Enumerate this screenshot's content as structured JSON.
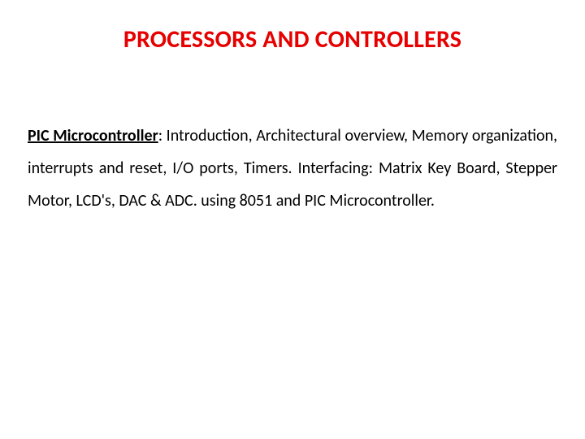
{
  "title": "PROCESSORS AND CONTROLLERS",
  "body": {
    "topic_label": "PIC Microcontroller",
    "description": ": Introduction, Architectural overview, Memory organization, interrupts and reset, I/O ports, Timers. Interfacing: Matrix Key Board, Stepper Motor, LCD's, DAC & ADC. using 8051 and PIC Microcontroller."
  }
}
